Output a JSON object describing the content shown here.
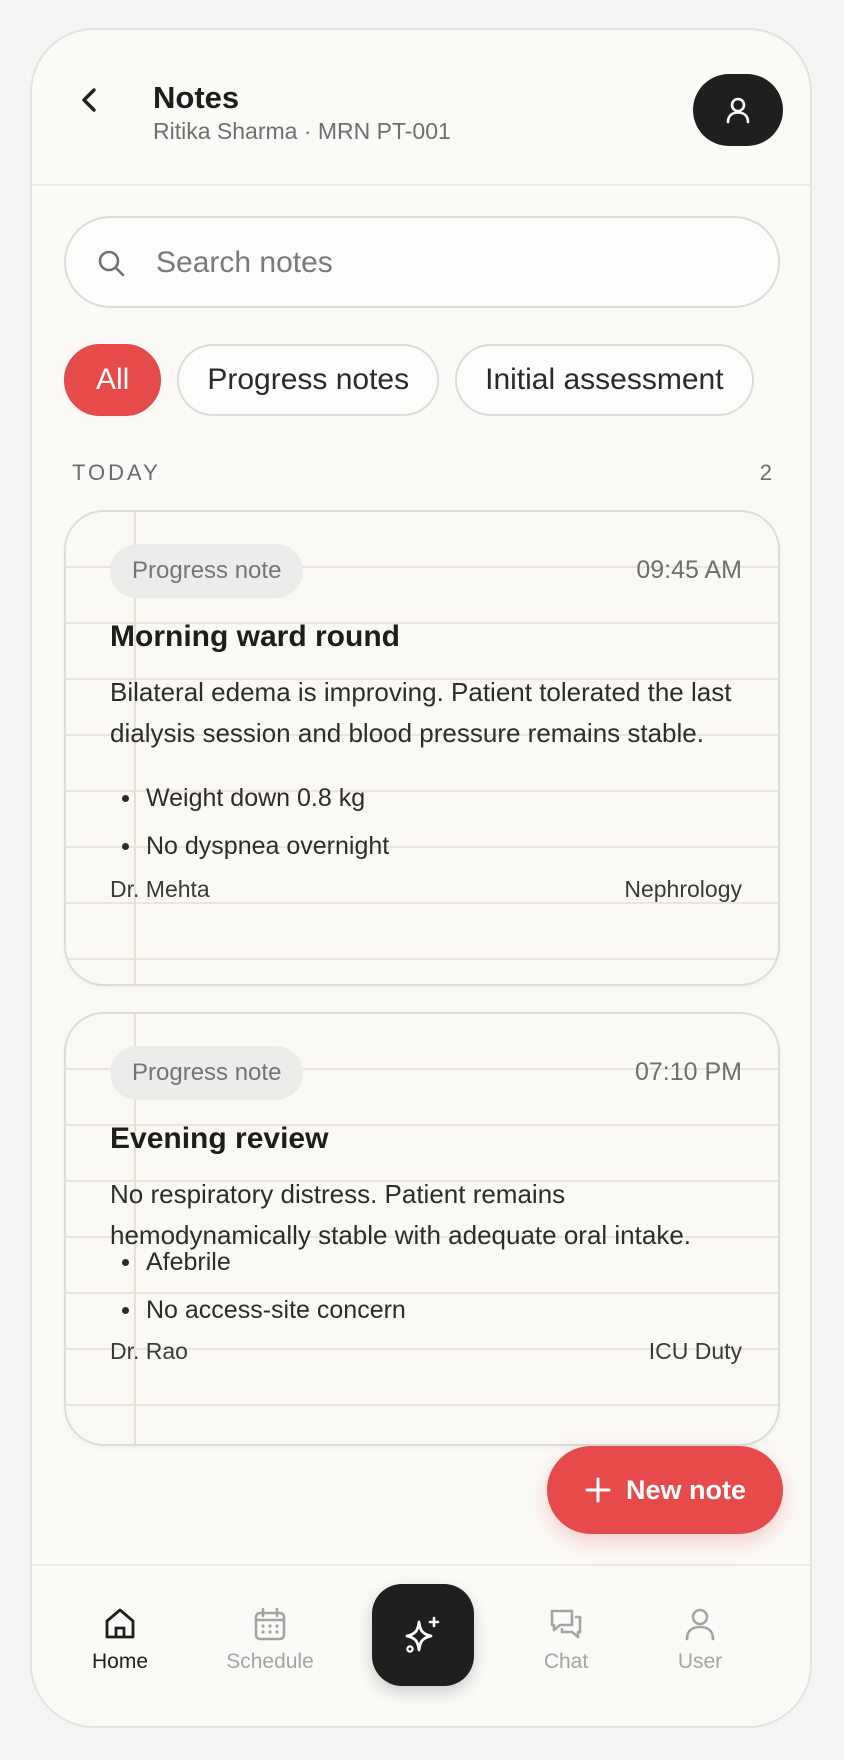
{
  "header": {
    "title": "Notes",
    "subtitle": "Ritika Sharma · MRN PT-001"
  },
  "search": {
    "placeholder": "Search notes"
  },
  "filters": [
    {
      "label": "All",
      "active": true
    },
    {
      "label": "Progress notes",
      "active": false
    },
    {
      "label": "Initial assessment",
      "active": false
    }
  ],
  "section": {
    "label": "TODAY",
    "count": "2"
  },
  "notes": [
    {
      "type": "Progress note",
      "time": "09:45 AM",
      "title": "Morning ward round",
      "body": "Bilateral edema is improving. Patient tolerated the last dialysis session and blood pressure remains stable.",
      "bullets": [
        "Weight down 0.8 kg",
        "No dyspnea overnight"
      ],
      "author": "Dr. Mehta",
      "department": "Nephrology"
    },
    {
      "type": "Progress note",
      "time": "07:10 PM",
      "title": "Evening review",
      "body": "No respiratory distress. Patient remains hemodynamically stable with adequate oral intake.",
      "bullets": [
        "Afebrile",
        "No access-site concern"
      ],
      "author": "Dr. Rao",
      "department": "ICU Duty"
    }
  ],
  "fab": {
    "label": "New note"
  },
  "nav": {
    "items": [
      {
        "label": "Home",
        "icon": "home-icon",
        "active": true
      },
      {
        "label": "Schedule",
        "icon": "calendar-icon",
        "active": false
      },
      {
        "label": "Chat",
        "icon": "chat-icon",
        "active": false
      },
      {
        "label": "User",
        "icon": "user-icon",
        "active": false
      }
    ],
    "center_icon": "sparkle-icon"
  },
  "colors": {
    "accent": "#e64a4a",
    "dark": "#1f1f1f",
    "background": "#fbfaf7"
  }
}
